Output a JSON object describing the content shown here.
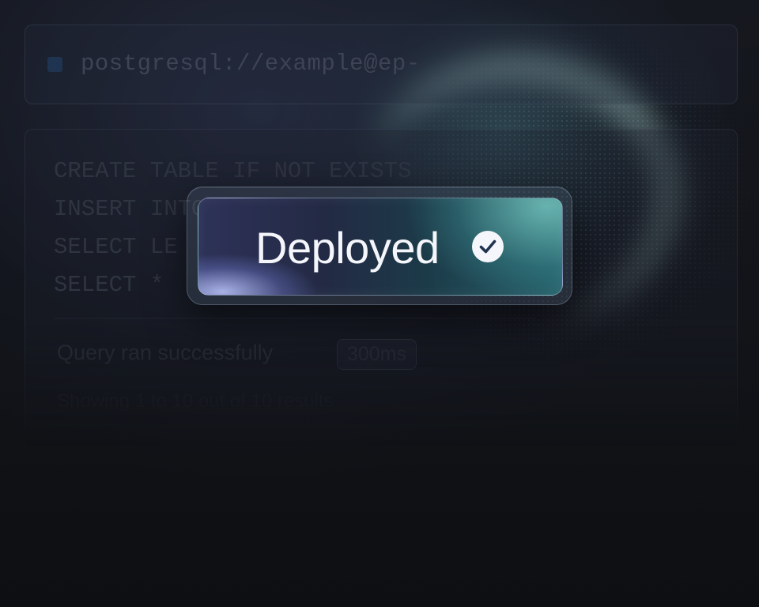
{
  "connection": {
    "string": "postgresql://example@ep-"
  },
  "editor": {
    "lines": [
      "CREATE TABLE IF NOT EXISTS",
      "INSERT INTO",
      "SELECT LE",
      "SELECT *"
    ],
    "status": "Query ran successfully",
    "duration": "300ms",
    "results": "Showing 1 to 10 out of 10 results"
  },
  "toast": {
    "label": "Deployed",
    "icon": "check-circle-icon"
  },
  "colors": {
    "background": "#0d0f12",
    "toast_start": "#2d3258",
    "toast_end": "#26616a",
    "text": "#f4f6fb"
  }
}
